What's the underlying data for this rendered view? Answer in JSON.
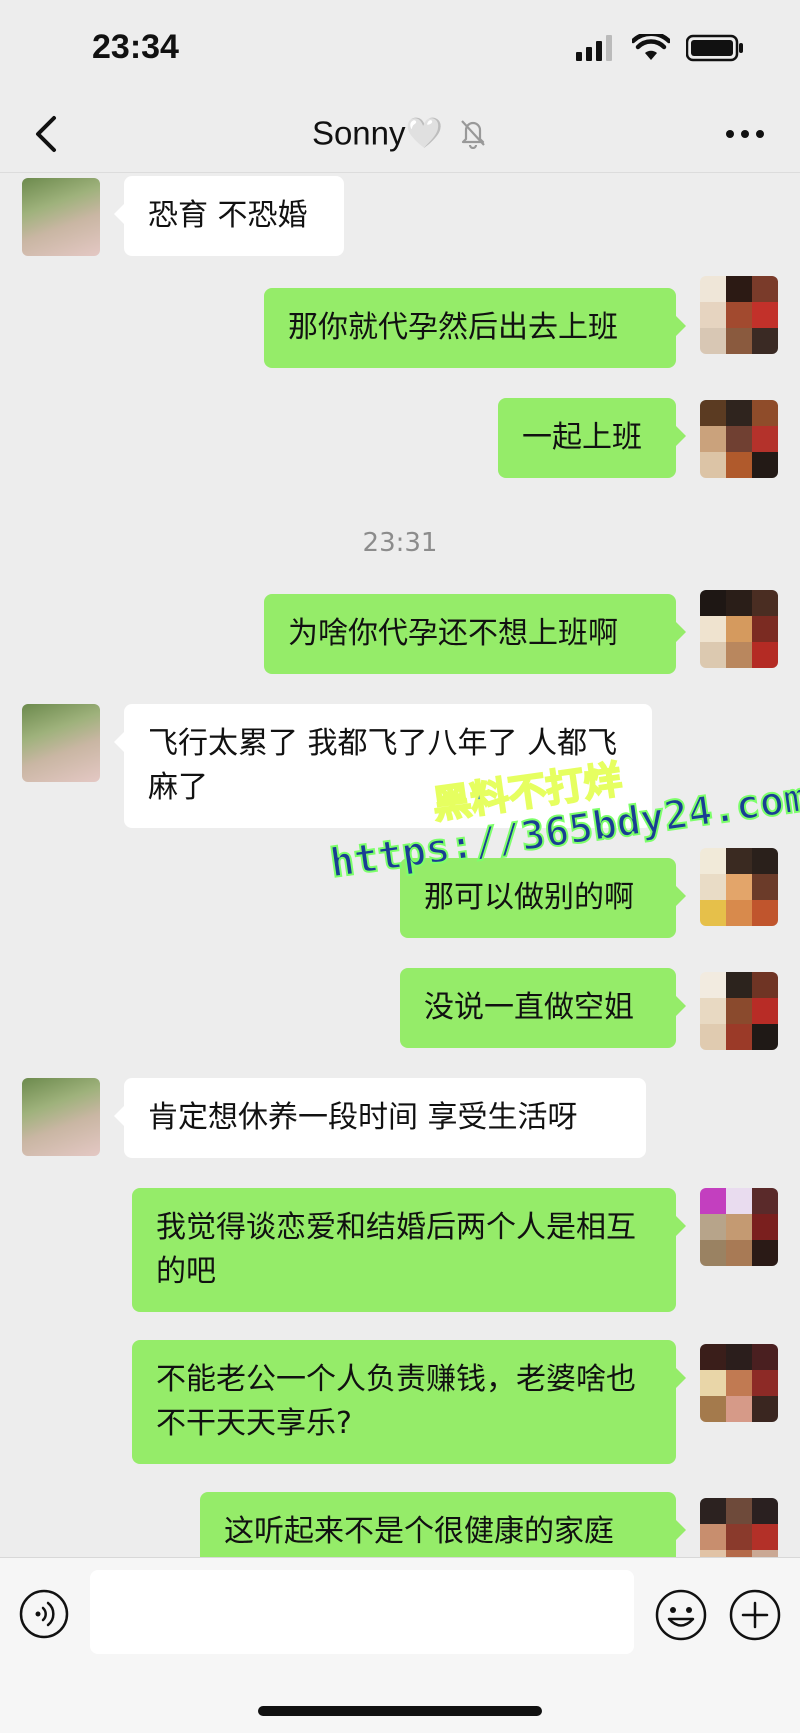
{
  "status_bar": {
    "time": "23:34"
  },
  "nav": {
    "title": "Sonny",
    "title_emoji": "🤍"
  },
  "messages": [
    {
      "side": "left",
      "text": "恐育 不恐婚"
    },
    {
      "side": "right",
      "text": "那你就代孕然后出去上班"
    },
    {
      "side": "right",
      "text": "一起上班"
    },
    {
      "side": "right",
      "text": "为啥你代孕还不想上班啊"
    },
    {
      "side": "left",
      "text": "飞行太累了 我都飞了八年了 人都飞麻了"
    },
    {
      "side": "right",
      "text": "那可以做别的啊"
    },
    {
      "side": "right",
      "text": "没说一直做空姐"
    },
    {
      "side": "left",
      "text": "肯定想休养一段时间 享受生活呀"
    },
    {
      "side": "right",
      "text": "我觉得谈恋爱和结婚后两个人是相互的吧"
    },
    {
      "side": "right",
      "text": "不能老公一个人负责赚钱，老婆啥也不干天天享乐?"
    },
    {
      "side": "right",
      "text": "这听起来不是个很健康的家庭"
    }
  ],
  "timestamp": "23:31",
  "watermark": {
    "line1": "黑料不打烊",
    "line2": "https://365bdy24.com"
  },
  "colors": {
    "bubble_right": "#95ec69",
    "bubble_left": "#ffffff",
    "background": "#ededed"
  },
  "icons": {
    "back": "chevron-left-icon",
    "mute": "bell-off-icon",
    "more": "ellipsis-icon",
    "voice": "voice-icon",
    "emoji": "emoji-icon",
    "plus": "plus-icon"
  }
}
